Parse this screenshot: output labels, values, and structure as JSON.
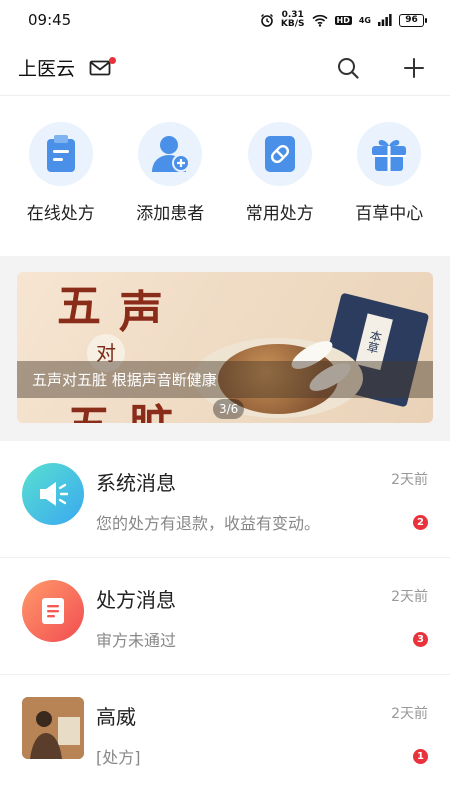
{
  "status_bar": {
    "time": "09:45",
    "speed_value": "0.31",
    "speed_unit": "KB/S",
    "hd": "HD",
    "network": "4G",
    "battery": "96"
  },
  "header": {
    "title": "上医云",
    "colors": {
      "accent": "#4a90e8",
      "badge": "#e8323c"
    }
  },
  "quick_actions": [
    {
      "label": "在线处方",
      "icon": "clipboard-icon"
    },
    {
      "label": "添加患者",
      "icon": "add-user-icon"
    },
    {
      "label": "常用处方",
      "icon": "pill-card-icon"
    },
    {
      "label": "百草中心",
      "icon": "gift-box-icon"
    }
  ],
  "banner": {
    "char_top_1": "五",
    "char_top_2": "声",
    "char_mid": "对",
    "char_bottom_1": "五",
    "char_bottom_2": "脏",
    "book_label": "本草",
    "caption": "五声对五脏 根据声音断健康",
    "page": "3/6"
  },
  "messages": [
    {
      "title": "系统消息",
      "subtitle": "您的处方有退款，收益有变动。",
      "time": "2天前",
      "badge": "2"
    },
    {
      "title": "处方消息",
      "subtitle": "审方未通过",
      "time": "2天前",
      "badge": "3"
    },
    {
      "title": "高威",
      "subtitle": "[处方]",
      "time": "2天前",
      "badge": "1"
    }
  ]
}
